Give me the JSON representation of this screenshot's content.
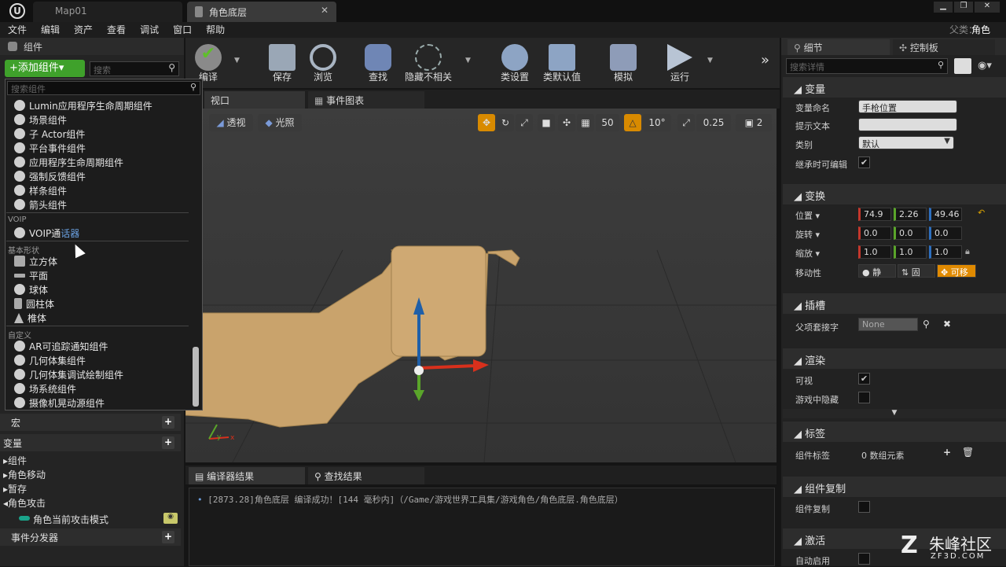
{
  "tabs": {
    "map": "Map01",
    "blueprint": "角色底层",
    "parent_label": "父类：",
    "parent_value": "角色"
  },
  "menu": [
    "文件",
    "编辑",
    "资产",
    "查看",
    "调试",
    "窗口",
    "帮助"
  ],
  "components_panel": {
    "title": "组件",
    "add_button": "+添加组件▾",
    "search_placeholder": "搜索",
    "dropdown_search_placeholder": "搜索组件"
  },
  "dropdown": {
    "items_top": [
      "Lumin应用程序生命周期组件",
      "场景组件",
      "子 Actor组件",
      "平台事件组件",
      "应用程序生命周期组件",
      "强制反馈组件",
      "样条组件",
      "箭头组件"
    ],
    "cat_voip": "VOIP",
    "voip_item_a": "VOIP通",
    "voip_item_b": "话器",
    "cat_basic": "基本形状",
    "basic_items": [
      "立方体",
      "平面",
      "球体",
      "圆柱体",
      "椎体"
    ],
    "cat_custom": "自定义",
    "custom_items": [
      "AR可追踪通知组件",
      "几何体集组件",
      "几何体集调试绘制组件",
      "场系统组件",
      "摄像机晃动源组件"
    ]
  },
  "mybp": {
    "macro": "宏",
    "variables": "变量",
    "groups": [
      "组件",
      "角色移动",
      "暂存",
      "角色攻击"
    ],
    "var_item": "角色当前攻击模式",
    "dispatcher": "事件分发器"
  },
  "toolbar": [
    "编译",
    "保存",
    "浏览",
    "查找",
    "隐藏不相关",
    "类设置",
    "类默认值",
    "模拟",
    "运行"
  ],
  "viewport": {
    "tab_viewport": "视口",
    "tab_graph": "事件图表",
    "perspective": "透视",
    "lit": "光照",
    "grid": "50",
    "rot": "10°",
    "scale": "0.25",
    "cam": "2"
  },
  "output": {
    "tab_compiler": "编译器结果",
    "tab_find": "查找结果",
    "log": "[2873.28]角色底层 编译成功！[144 毫秒内]（/Game/游戏世界工具集/游戏角色/角色底层.角色底层）"
  },
  "details": {
    "tab_details": "细节",
    "tab_palette": "控制板",
    "search_placeholder": "搜索详情",
    "sec_variable": "变量",
    "var_name_label": "变量命名",
    "var_name": "手枪位置",
    "tooltip_label": "提示文本",
    "category_label": "类别",
    "category": "默认",
    "inherit_label": "继承时可编辑",
    "sec_transform": "变换",
    "loc_label": "位置 ▾",
    "loc": [
      "74.9",
      "2.26",
      "49.46"
    ],
    "rot_label": "旋转 ▾",
    "rot": [
      "0.0",
      "0.0",
      "0.0"
    ],
    "scale_label": "缩放 ▾",
    "scale": [
      "1.0",
      "1.0",
      "1.0"
    ],
    "mob_label": "移动性",
    "mob": [
      "静",
      "固",
      "可移"
    ],
    "sec_socket": "插槽",
    "parent_socket_label": "父项套接字",
    "parent_socket": "None",
    "sec_render": "渲染",
    "visible_label": "可视",
    "hidden_label": "游戏中隐藏",
    "sec_tags": "标签",
    "comp_tags_label": "组件标签",
    "comp_tags": "0 数组元素",
    "sec_replication": "组件复制",
    "replicate_label": "组件复制",
    "sec_activation": "激活",
    "autoactivate_label": "自动启用"
  },
  "watermark": {
    "name": "朱峰社区",
    "url": "ZF3D.COM"
  },
  "colors": {
    "accent_green": "#4caf22",
    "orange": "#e08a00",
    "bg": "#242424",
    "viewport": "#3a3a3a"
  }
}
